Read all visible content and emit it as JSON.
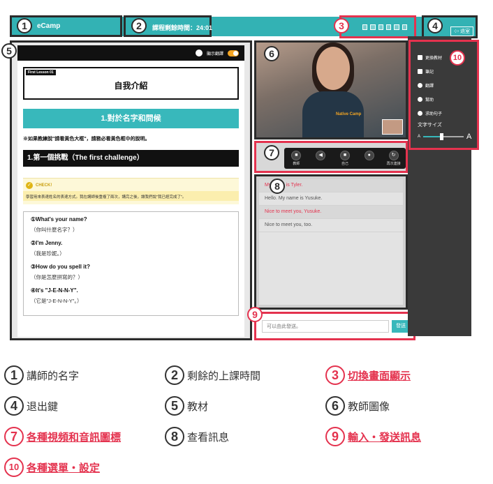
{
  "topbar": {
    "teacher_name": "eCamp",
    "timer_label": "課程剩餘時間：24:01",
    "exit_label": "退室"
  },
  "material": {
    "translate_label": "顯示翻譯",
    "lesson_tag": "First Lesson 01",
    "lesson_title": "自我介紹",
    "section1": "1.對於名字和問候",
    "note": "※如果教練說\"請看黃色大框\"，請務必看黃色框中的說明。",
    "section2": "1.第一個挑戰（The first challenge）",
    "check_label": "CHECK!",
    "check_text": "學習用來表達姓名的表達方式。我在講師後重複了兩次，講完之後，讓我們說\"我已經完成了\"。",
    "dialog": [
      {
        "en": "①What's your name?",
        "zh": "（你叫什麼名字？）"
      },
      {
        "en": "②I'm Jenny.",
        "zh": "（我是珍妮。）"
      },
      {
        "en": "③How do you spell it?",
        "zh": "（你是怎麼拼寫的？）"
      },
      {
        "en": "④It's \"J-E-N-N-Y\".",
        "zh": "（它是\"J-E-N-N-Y\"。）"
      }
    ]
  },
  "video": {
    "shirt_logo": "Native Camp"
  },
  "av_controls": [
    {
      "icon": "camera-icon",
      "glyph": "■",
      "caption": "教師"
    },
    {
      "icon": "speaker-icon",
      "glyph": "◀",
      "caption": ""
    },
    {
      "icon": "camera-self-icon",
      "glyph": "■",
      "caption": "自己"
    },
    {
      "icon": "microphone-icon",
      "glyph": "●",
      "caption": ""
    },
    {
      "icon": "reconnect-icon",
      "glyph": "↻",
      "caption": "再次連接"
    }
  ],
  "chat": {
    "messages": [
      {
        "text": "My name is Tyler.",
        "highlight": true
      },
      {
        "text": "Hello. My name is Yusuke.",
        "highlight": false
      },
      {
        "text": "Nice to meet you, Yusuke.",
        "highlight": true
      },
      {
        "text": "Nice to meet you, too.",
        "highlight": false
      }
    ],
    "input_placeholder": "可以由此發送。",
    "send_label": "發送"
  },
  "right_menu": {
    "items": [
      {
        "icon": "book-icon",
        "label": "更換教材"
      },
      {
        "icon": "note-icon",
        "label": "筆記"
      },
      {
        "icon": "translate-icon",
        "label": "翻譯"
      },
      {
        "icon": "help-icon",
        "label": "幫助"
      },
      {
        "icon": "phrase-icon",
        "label": "求助句子"
      }
    ],
    "font_size_label": "文字サイズ",
    "font_size_small": "A",
    "font_size_big": "A",
    "font_size_level": 0.45
  },
  "callouts": [
    "1",
    "2",
    "3",
    "4",
    "5",
    "6",
    "7",
    "8",
    "9",
    "10"
  ],
  "legend": [
    {
      "num": "1",
      "text": "講師的名字",
      "highlight": false
    },
    {
      "num": "2",
      "text": "剩餘的上課時間",
      "highlight": false
    },
    {
      "num": "3",
      "text": "切換畫面顯示",
      "highlight": true
    },
    {
      "num": "4",
      "text": "退出鍵",
      "highlight": false
    },
    {
      "num": "5",
      "text": "教材",
      "highlight": false
    },
    {
      "num": "6",
      "text": "教師圖像",
      "highlight": false
    },
    {
      "num": "7",
      "text": "各種視頻和音訊圖標",
      "highlight": true
    },
    {
      "num": "8",
      "text": "查看訊息",
      "highlight": false
    },
    {
      "num": "9",
      "text": "輸入・發送訊息",
      "highlight": true
    },
    {
      "num": "10",
      "text": "各種選單・設定",
      "highlight": true
    }
  ],
  "colors": {
    "teal": "#33b2b4",
    "highlight_red": "#e4324e",
    "dark_border": "#2b2b2b"
  }
}
